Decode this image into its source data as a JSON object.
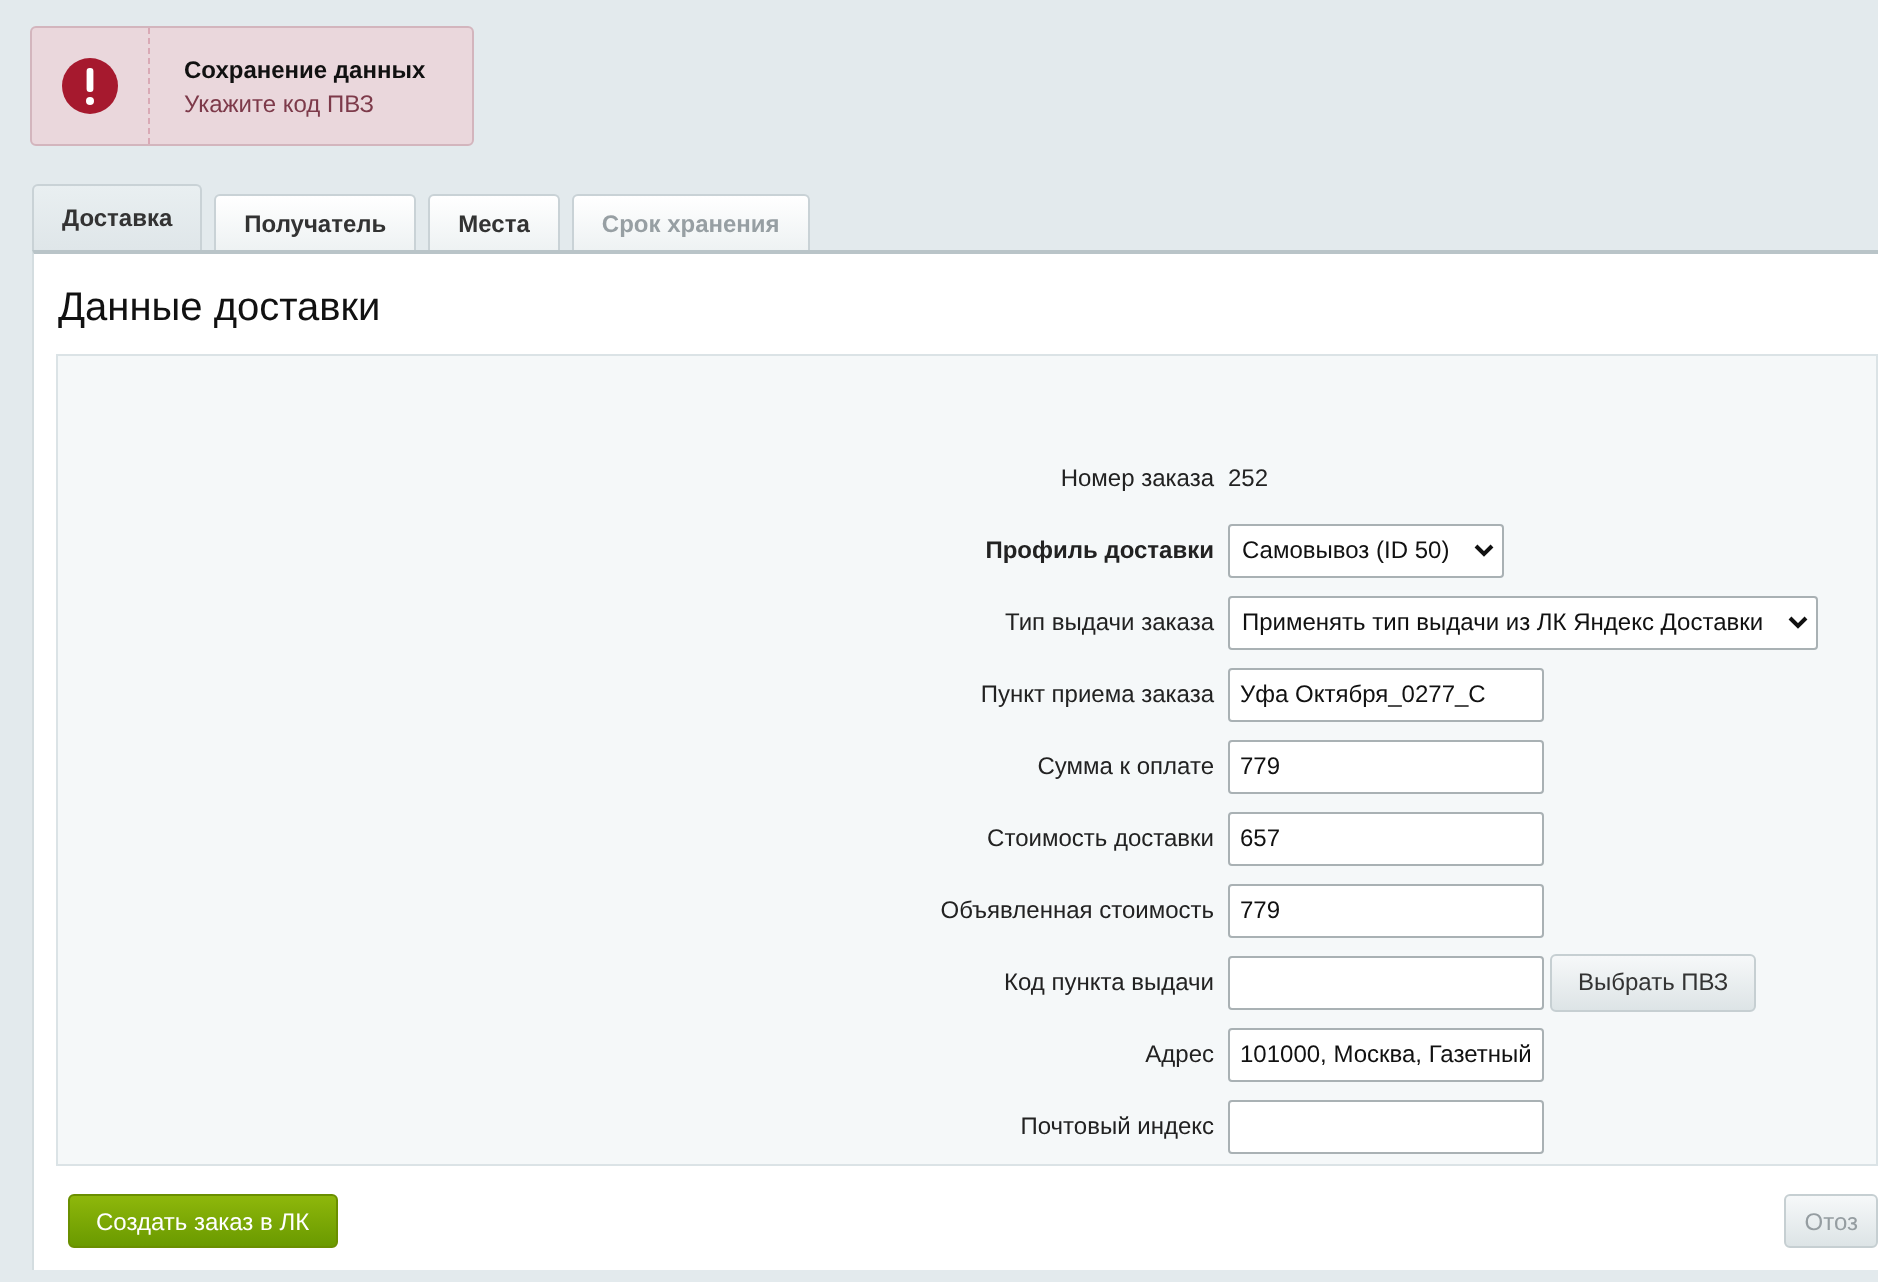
{
  "alert": {
    "title": "Сохранение данных",
    "message": "Укажите код ПВЗ"
  },
  "tabs": [
    {
      "label": "Доставка",
      "selected": true,
      "disabled": false
    },
    {
      "label": "Получатель",
      "selected": false,
      "disabled": false
    },
    {
      "label": "Места",
      "selected": false,
      "disabled": false
    },
    {
      "label": "Срок хранения",
      "selected": false,
      "disabled": true
    }
  ],
  "section_title": "Данные доставки",
  "fields": [
    {
      "kind": "static",
      "label": "Номер заказа",
      "bold": false,
      "value": "252"
    },
    {
      "kind": "select",
      "label": "Профиль доставки",
      "bold": true,
      "value": "Самовывоз (ID 50)"
    },
    {
      "kind": "select",
      "label": "Тип выдачи заказа",
      "bold": false,
      "value": "Применять тип выдачи из ЛК Яндекс Доставки"
    },
    {
      "kind": "text",
      "label": "Пункт приема заказа",
      "bold": false,
      "value": "Уфа Октября_0277_С"
    },
    {
      "kind": "text",
      "label": "Сумма к оплате",
      "bold": false,
      "value": "779"
    },
    {
      "kind": "text",
      "label": "Стоимость доставки",
      "bold": false,
      "value": "657"
    },
    {
      "kind": "text",
      "label": "Объявленная стоимость",
      "bold": false,
      "value": "779"
    },
    {
      "kind": "text_button",
      "label": "Код пункта выдачи",
      "bold": false,
      "button": "Выбрать ПВЗ"
    },
    {
      "kind": "text",
      "label": "Адрес",
      "bold": false,
      "value": "101000, Москва, Газетный"
    },
    {
      "kind": "text",
      "label": "Почтовый индекс",
      "bold": false
    }
  ],
  "buttons": [
    {
      "label": "Создать заказ в ЛК",
      "disabled": false
    },
    {
      "label": "Отоз",
      "disabled": true
    }
  ]
}
